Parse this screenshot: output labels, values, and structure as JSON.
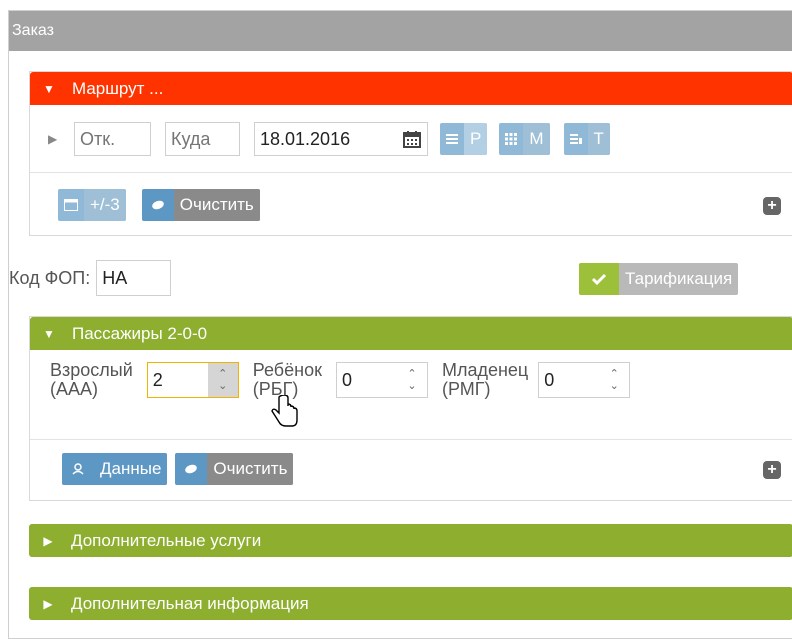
{
  "window": {
    "title": "Заказ"
  },
  "route": {
    "header": "Маршрут ...",
    "from_placeholder": "Отк.",
    "to_placeholder": "Куда",
    "date_value": "18.01.2016",
    "btn_p": "Р",
    "btn_m": "М",
    "btn_t": "Т",
    "btn_range": "+/-3",
    "btn_clear": "Очистить"
  },
  "fop": {
    "label": "Код ФОП:",
    "value": "НА",
    "tariff_button": "Тарификация"
  },
  "passengers": {
    "header": "Пассажиры 2-0-0",
    "adult_label_1": "Взрослый",
    "adult_label_2": "(ААА)",
    "adult_value": "2",
    "child_label_1": "Ребёнок",
    "child_label_2": "(РБГ)",
    "child_value": "0",
    "infant_label_1": "Младенец",
    "infant_label_2": "(РМГ)",
    "infant_value": "0",
    "data_button": "Данные",
    "clear_button": "Очистить"
  },
  "extra_services": {
    "header": "Дополнительные услуги"
  },
  "extra_info": {
    "header": "Дополнительная информация"
  },
  "icons": [
    "caret-down-icon",
    "caret-right-icon",
    "calendar-icon",
    "list-icon",
    "grid-icon",
    "table-icon",
    "eraser-icon",
    "plus-icon",
    "check-icon",
    "user-icon",
    "hand-cursor-icon"
  ],
  "colors": {
    "route_header": "#ff3300",
    "section_header": "#8dae2e",
    "window_header": "#a3a3a3",
    "primary_button": "#5d97c3"
  }
}
